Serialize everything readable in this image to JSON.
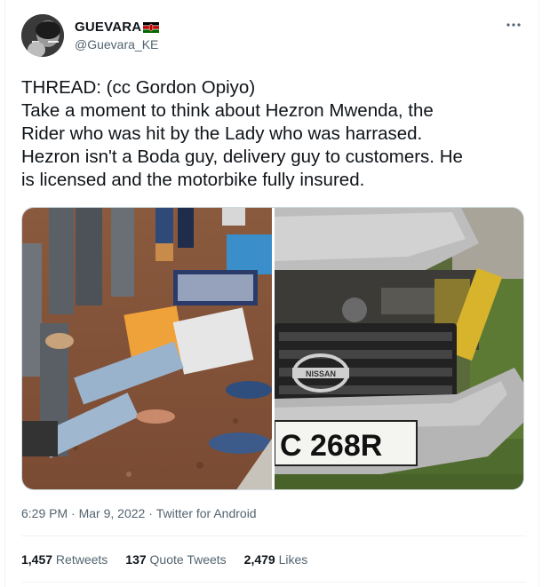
{
  "user": {
    "display_name": "GUEVARA",
    "handle": "@Guevara_KE"
  },
  "icons": {
    "more": "more-icon",
    "flag": "kenya-flag-icon"
  },
  "tweet": {
    "lines": [
      "THREAD:  (cc Gordon Opiyo)",
      "Take a moment to think about Hezron Mwenda, the",
      "Rider who was hit by the Lady who was harrased.",
      "Hezron isn't a Boda guy, delivery guy to customers. He",
      "is licensed and the motorbike fully insured."
    ]
  },
  "media": {
    "car_plate": "C 268R",
    "car_badge": "NISSAN"
  },
  "meta": {
    "time": "6:29 PM",
    "sep1": " · ",
    "date": "Mar 9, 2022",
    "sep2": " · ",
    "source": "Twitter for Android"
  },
  "stats": {
    "retweets_count": "1,457",
    "retweets_label": " Retweets",
    "quotes_count": "137",
    "quotes_label": " Quote Tweets",
    "likes_count": "2,479",
    "likes_label": " Likes"
  },
  "colors": {
    "text": "#0f1419",
    "secondary": "#536471",
    "border": "#eff3f4"
  }
}
